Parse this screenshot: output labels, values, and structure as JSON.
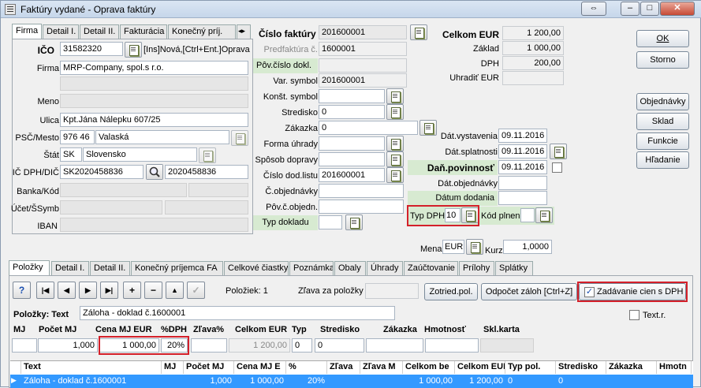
{
  "window": {
    "title": "Faktúry vydané - Oprava faktúry",
    "ctrl_arrows": "⇔",
    "ctrl_min": "–",
    "ctrl_max": "□",
    "ctrl_close": "✕"
  },
  "left_tabs": [
    "Firma",
    "Detail I.",
    "Detail II.",
    "Fakturácia",
    "Konečný príj."
  ],
  "firm": {
    "ico_label": "IČO",
    "ico": "31582320",
    "ico_hint": "[Ins]Nová,[Ctrl+Ent.]Oprava",
    "firma_label": "Firma",
    "firma": "MRP-Company, spol.s r.o.",
    "meno_label": "Meno",
    "meno": "",
    "ulica_label": "Ulica",
    "ulica": "Kpt.Jána Nálepku 607/25",
    "psc_label": "PSČ/Mesto",
    "psc": "976 46",
    "mesto": "Valaská",
    "stat_label": "Štát",
    "stat_code": "SK",
    "stat": "Slovensko",
    "icdph_label": "IČ DPH/DIČ",
    "icdph": "SK2020458836",
    "dic": "2020458836",
    "banka_label": "Banka/Kód",
    "ucet_label": "Účet/ŠSymb",
    "iban_label": "IBAN"
  },
  "invoice": {
    "cislo_label": "Číslo faktúry",
    "cislo": "201600001",
    "predfakt_label": "Predfaktúra č.",
    "predfakt": "1600001",
    "pov_label": "Pôv.číslo dokl.",
    "vs_label": "Var. symbol",
    "vs": "201600001",
    "ks_label": "Konšt. symbol",
    "ks": "",
    "stredisko_label": "Stredisko",
    "stredisko": "0",
    "zakazka_label": "Zákazka",
    "zakazka": "0",
    "forma_label": "Forma úhrady",
    "sposob_label": "Spôsob dopravy",
    "dodlist_label": "Číslo dod.listu",
    "dodlist": "201600001",
    "objedn_label": "Č.objednávky",
    "povobj_label": "Pôv.č.objedn.",
    "typdokl_label": "Typ dokladu"
  },
  "totals": {
    "celkom_label": "Celkom EUR",
    "celkom": "1 200,00",
    "zaklad_label": "Základ",
    "zaklad": "1 000,00",
    "dph_label": "DPH",
    "dph": "200,00",
    "uhradit_label": "Uhradiť EUR",
    "uhradit": ""
  },
  "dates": {
    "vyst_label": "Dát.vystavenia",
    "vyst": "09.11.2016",
    "splat_label": "Dát.splatnosti",
    "splat": "09.11.2016",
    "povin_label": "Daň.povinnosť",
    "povin": "09.11.2016",
    "objedn_label": "Dát.objednávky",
    "dodania_label": "Dátum dodania",
    "typdph_label": "Typ DPH",
    "typdph": "10",
    "kodplnen_label": "Kód plnen.",
    "mena_label": "Mena",
    "mena": "EUR",
    "kurz_label": "Kurz",
    "kurz": "1,0000"
  },
  "right_buttons": {
    "ok": "OK",
    "storno": "Storno",
    "objednavky": "Objednávky",
    "sklad": "Sklad",
    "funkcie": "Funkcie",
    "hladanie": "Hľadanie"
  },
  "bottom_tabs": [
    "Položky",
    "Detail I.",
    "Detail II.",
    "Konečný príjemca FA",
    "Celkové čiastky",
    "Poznámka",
    "Obaly",
    "Úhrady",
    "Zaúčtovanie",
    "Prílohy",
    "Splátky"
  ],
  "toolbar": {
    "help": "?",
    "first": "|◀",
    "prev": "◀",
    "next": "▶",
    "last": "▶|",
    "add": "+",
    "remove": "−",
    "up": "▲",
    "check": "✓",
    "count_label": "Položiek: 1",
    "zlava_label": "Zľava za položky",
    "zoradit": "Zotried.pol.",
    "odpocet": "Odpočet záloh [Ctrl+Z]",
    "zadavanie": "Zadávanie cien s DPH",
    "zadavanie_checked": "✓"
  },
  "item": {
    "label": "Položky: Text",
    "text": "Záloha - doklad č.1600001",
    "textr": "Text.r.",
    "h_mj": "MJ",
    "h_pocet": "Počet MJ",
    "h_cena": "Cena MJ EUR",
    "h_dph": "%DPH",
    "h_zlava": "Zľava%",
    "h_celkom": "Celkom EUR",
    "h_typ": "Typ",
    "h_stred": "Stredisko",
    "h_zak": "Zákazka",
    "h_hmot": "Hmotnosť",
    "h_skl": "Skl.karta",
    "mj": "",
    "pocet": "1,000",
    "cena": "1 000,00",
    "dph": "20%",
    "zlava": "",
    "celkom": "1 200,00",
    "typ": "0",
    "stred": "0",
    "zak": ""
  },
  "grid": {
    "headers": [
      "Text",
      "MJ",
      "Počet MJ",
      "Cena MJ E",
      "%",
      "Zľava",
      "Zľava M",
      "Celkom be",
      "Celkom EUR",
      "Typ pol.",
      "Stredisko",
      "Zákazka",
      "Hmotn"
    ],
    "row": [
      "Záloha - doklad č.1600001",
      "",
      "1,000",
      "1 000,00",
      "20%",
      "",
      "",
      "1 000,00",
      "1 200,00",
      "0",
      "0",
      "",
      ""
    ]
  },
  "colors": {
    "grid_selection": "#3399ff",
    "highlight": "#d4202a",
    "label_green": "#d7ead1"
  }
}
